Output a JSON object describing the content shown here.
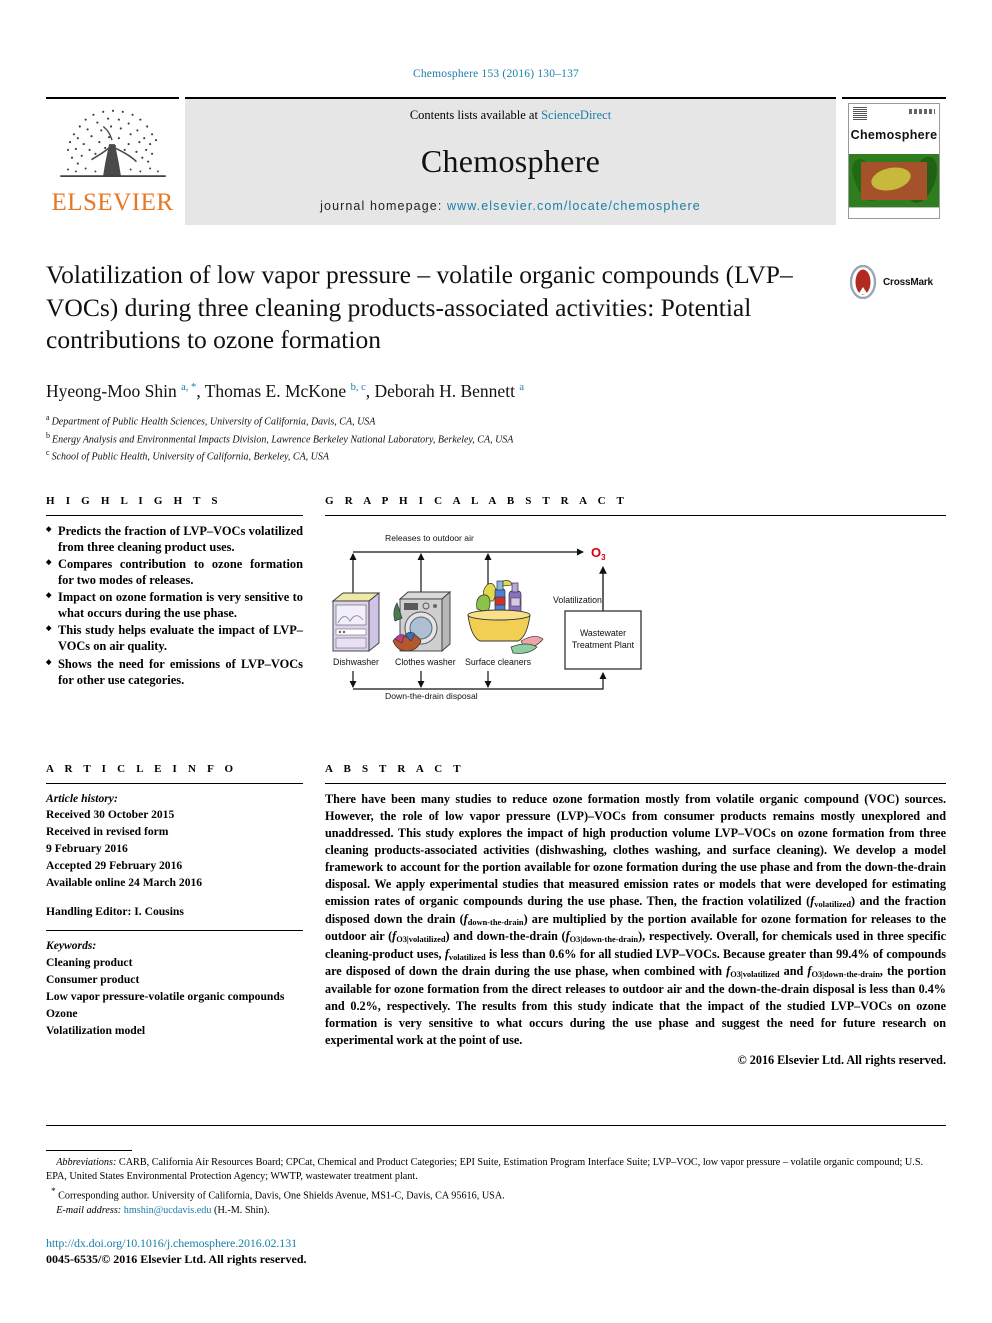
{
  "running_head": "Chemosphere 153 (2016) 130–137",
  "masthead": {
    "contents_prefix": "Contents lists available at ",
    "sciencedirect": "ScienceDirect",
    "journal_name": "Chemosphere",
    "homepage_prefix": "journal homepage: ",
    "homepage_url": "www.elsevier.com/locate/chemosphere",
    "publisher": "ELSEVIER",
    "cover_title": "Chemosphere",
    "accent_blue": "#1a7fa8",
    "elsevier_orange": "#E87722"
  },
  "article": {
    "title": "Volatilization of low vapor pressure – volatile organic compounds (LVP–VOCs) during three cleaning products-associated activities: Potential contributions to ozone formation",
    "crossmark_label": "CrossMark",
    "authors_html": "Hyeong-Moo Shin <sup>a, *</sup>, Thomas E. McKone <sup>b, c</sup>, Deborah H. Bennett <sup>a</sup>",
    "affiliations": [
      {
        "marker": "a",
        "text": "Department of Public Health Sciences, University of California, Davis, CA, USA"
      },
      {
        "marker": "b",
        "text": "Energy Analysis and Environmental Impacts Division, Lawrence Berkeley National Laboratory, Berkeley, CA, USA"
      },
      {
        "marker": "c",
        "text": "School of Public Health, University of California, Berkeley, CA, USA"
      }
    ]
  },
  "highlights": {
    "heading": "H I G H L I G H T S",
    "items": [
      "Predicts the fraction of LVP–VOCs volatilized from three cleaning product uses.",
      "Compares contribution to ozone formation for two modes of releases.",
      "Impact on ozone formation is very sensitive to what occurs during the use phase.",
      "This study helps evaluate the impact of LVP–VOCs on air quality.",
      "Shows the need for emissions of LVP–VOCs for other use categories."
    ]
  },
  "graphical_abstract": {
    "heading": "G R A P H I C A L   A B S T R A C T",
    "top_arrow_label": "Releases to outdoor air",
    "bottom_arrow_label": "Down-the-drain disposal",
    "volatilization_label": "Volatilization",
    "ozone_label": "O",
    "ozone_sub": "3",
    "ozone_color": "#d8000c",
    "wwtp_label_line1": "Wastewater",
    "wwtp_label_line2": "Treatment Plant",
    "sources": [
      {
        "label": "Dishwasher"
      },
      {
        "label": "Clothes washer"
      },
      {
        "label": "Surface cleaners"
      }
    ]
  },
  "article_info": {
    "heading": "A R T I C L E   I N F O",
    "history_label": "Article history:",
    "history": [
      "Received 30 October 2015",
      "Received in revised form",
      "9 February 2016",
      "Accepted 29 February 2016",
      "Available online 24 March 2016"
    ],
    "handling_editor": "Handling Editor: I. Cousins",
    "keywords_label": "Keywords:",
    "keywords": [
      "Cleaning product",
      "Consumer product",
      "Low vapor pressure-volatile organic compounds",
      "Ozone",
      "Volatilization model"
    ]
  },
  "abstract": {
    "heading": "A B S T R A C T",
    "paragraph_html": "There have been many studies to reduce ozone formation mostly from volatile organic compound (VOC) sources. However, the role of low vapor pressure (LVP)–VOCs from consumer products remains mostly unexplored and unaddressed. This study explores the impact of high production volume LVP–VOCs on ozone formation from three cleaning products-associated activities (dishwashing, clothes washing, and surface cleaning). We develop a model framework to account for the portion available for ozone formation during the use phase and from the down-the-drain disposal. We apply experimental studies that measured emission rates or models that were developed for estimating emission rates of organic compounds during the use phase. Then, the fraction volatilized (<i>f</i><sub>volatilized</sub>) and the fraction disposed down the drain (<i>f</i><sub>down-the-drain</sub>) are multiplied by the portion available for ozone formation for releases to the outdoor air (<i>f</i><sub>O3|volatilized</sub>) and down-the-drain (<i>f</i><sub>O3|down-the-drain</sub>), respectively. Overall, for chemicals used in three specific cleaning-product uses, <i>f</i><sub>volatilized</sub> is less than 0.6% for all studied LVP–VOCs. Because greater than 99.4% of compounds are disposed of down the drain during the use phase, when combined with <i>f</i><sub>O3|volatilized</sub> and <i>f</i><sub>O3|down-the-drain</sub>, the portion available for ozone formation from the direct releases to outdoor air and the down-the-drain disposal is less than 0.4% and 0.2%, respectively. The results from this study indicate that the impact of the studied LVP–VOCs on ozone formation is very sensitive to what occurs during the use phase and suggest the need for future research on experimental work at the point of use.",
    "copyright": "© 2016 Elsevier Ltd. All rights reserved."
  },
  "footer": {
    "abbreviations_label": "Abbreviations:",
    "abbreviations_text": " CARB, California Air Resources Board; CPCat, Chemical and Product Categories; EPI Suite, Estimation Program Interface Suite; LVP–VOC, low vapor pressure – volatile organic compound; U.S. EPA, United States Environmental Protection Agency; WWTP, wastewater treatment plant.",
    "corresponding_author": "Corresponding author. University of California, Davis, One Shields Avenue, MS1-C, Davis, CA 95616, USA.",
    "email_label": "E-mail address:",
    "email": "hmshin@ucdavis.edu",
    "email_suffix": " (H.-M. Shin).",
    "doi": "http://dx.doi.org/10.1016/j.chemosphere.2016.02.131",
    "issn_line": "0045-6535/© 2016 Elsevier Ltd. All rights reserved."
  }
}
